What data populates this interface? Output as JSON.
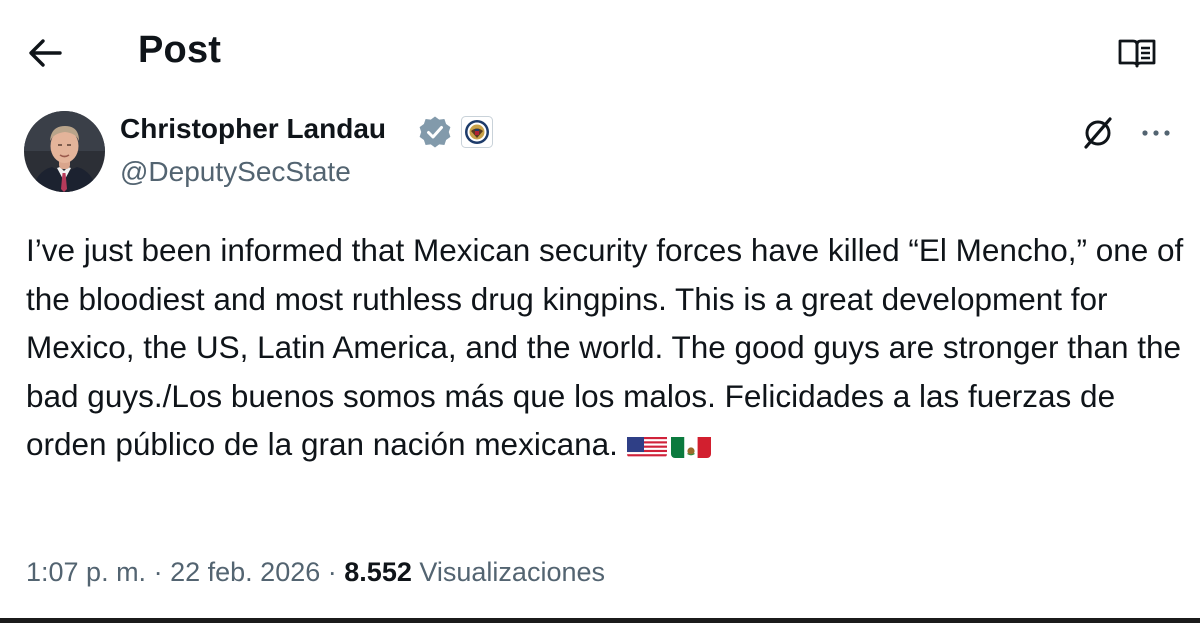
{
  "header": {
    "title": "Post",
    "back_icon": "arrow-left-icon",
    "reader_icon": "book-open-icon"
  },
  "tweet": {
    "author": {
      "name": "Christopher Landau",
      "handle": "@DeputySecState",
      "verified_badge": "verified-badge-gray",
      "affiliate_badge": "us-state-department-seal"
    },
    "actions": {
      "grok_icon": "grok-icon",
      "more_icon": "more-horizontal-icon"
    },
    "text": "I’ve just been informed that Mexican security forces have killed “El Mencho,” one of the bloodiest and most ruthless drug kingpins. This is a great development for Mexico, the US, Latin America, and the world. The good guys are stronger than the bad guys./Los buenos somos más que los malos. Felicidades a las fuerzas de orden público de la gran nación mexicana.",
    "emojis": [
      "flag-united-states",
      "flag-mexico"
    ],
    "time": "1:07 p. m.",
    "separator": "·",
    "date": "22 feb. 2026",
    "views_count": "8.552",
    "views_label": "Visualizaciones"
  },
  "colors": {
    "text_primary": "#0f1419",
    "text_secondary": "#536471",
    "verified_gray": "#829aab"
  }
}
